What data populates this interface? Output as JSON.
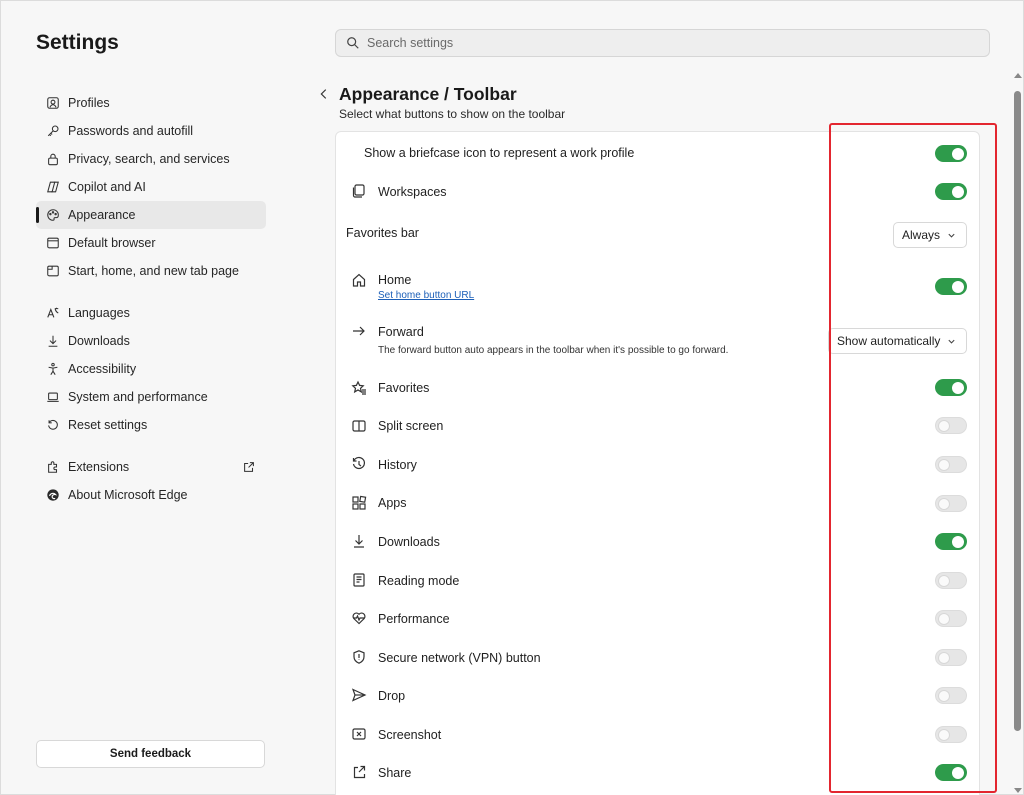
{
  "sidebar": {
    "title": "Settings",
    "items": [
      {
        "label": "Profiles",
        "icon": "profile-icon"
      },
      {
        "label": "Passwords and autofill",
        "icon": "key-icon"
      },
      {
        "label": "Privacy, search, and services",
        "icon": "lock-icon"
      },
      {
        "label": "Copilot and AI",
        "icon": "copilot-icon"
      },
      {
        "label": "Appearance",
        "icon": "palette-icon",
        "active": true
      },
      {
        "label": "Default browser",
        "icon": "browser-icon"
      },
      {
        "label": "Start, home, and new tab page",
        "icon": "tab-page-icon"
      },
      {
        "label": "Languages",
        "icon": "language-icon"
      },
      {
        "label": "Downloads",
        "icon": "download-icon"
      },
      {
        "label": "Accessibility",
        "icon": "accessibility-icon"
      },
      {
        "label": "System and performance",
        "icon": "laptop-icon"
      },
      {
        "label": "Reset settings",
        "icon": "reset-icon"
      },
      {
        "label": "Extensions",
        "icon": "extensions-icon"
      },
      {
        "label": "About Microsoft Edge",
        "icon": "edge-icon"
      }
    ],
    "feedback_label": "Send feedback"
  },
  "search": {
    "placeholder": "Search settings"
  },
  "header": {
    "title": "Appearance / Toolbar",
    "subtitle": "Select what buttons to show on the toolbar"
  },
  "settings": {
    "briefcase": {
      "label": "Show a briefcase icon to represent a work profile",
      "enabled": true
    },
    "workspaces": {
      "label": "Workspaces",
      "enabled": true
    },
    "favorites_bar": {
      "label": "Favorites bar",
      "value": "Always"
    },
    "home": {
      "label": "Home",
      "link": "Set home button URL",
      "enabled": true
    },
    "forward": {
      "label": "Forward",
      "description": "The forward button auto appears in the toolbar when it's possible to go forward.",
      "value": "Show automatically"
    },
    "favorites": {
      "label": "Favorites",
      "enabled": true
    },
    "split_screen": {
      "label": "Split screen",
      "enabled": false
    },
    "history": {
      "label": "History",
      "enabled": false
    },
    "apps": {
      "label": "Apps",
      "enabled": false
    },
    "downloads": {
      "label": "Downloads",
      "enabled": true
    },
    "reading_mode": {
      "label": "Reading mode",
      "enabled": false
    },
    "performance": {
      "label": "Performance",
      "enabled": false
    },
    "vpn": {
      "label": "Secure network (VPN) button",
      "enabled": false
    },
    "drop": {
      "label": "Drop",
      "enabled": false
    },
    "screenshot": {
      "label": "Screenshot",
      "enabled": false
    },
    "share": {
      "label": "Share",
      "enabled": true
    }
  },
  "colors": {
    "toggle_on": "#2e9b4b",
    "highlight": "#e3262f"
  }
}
